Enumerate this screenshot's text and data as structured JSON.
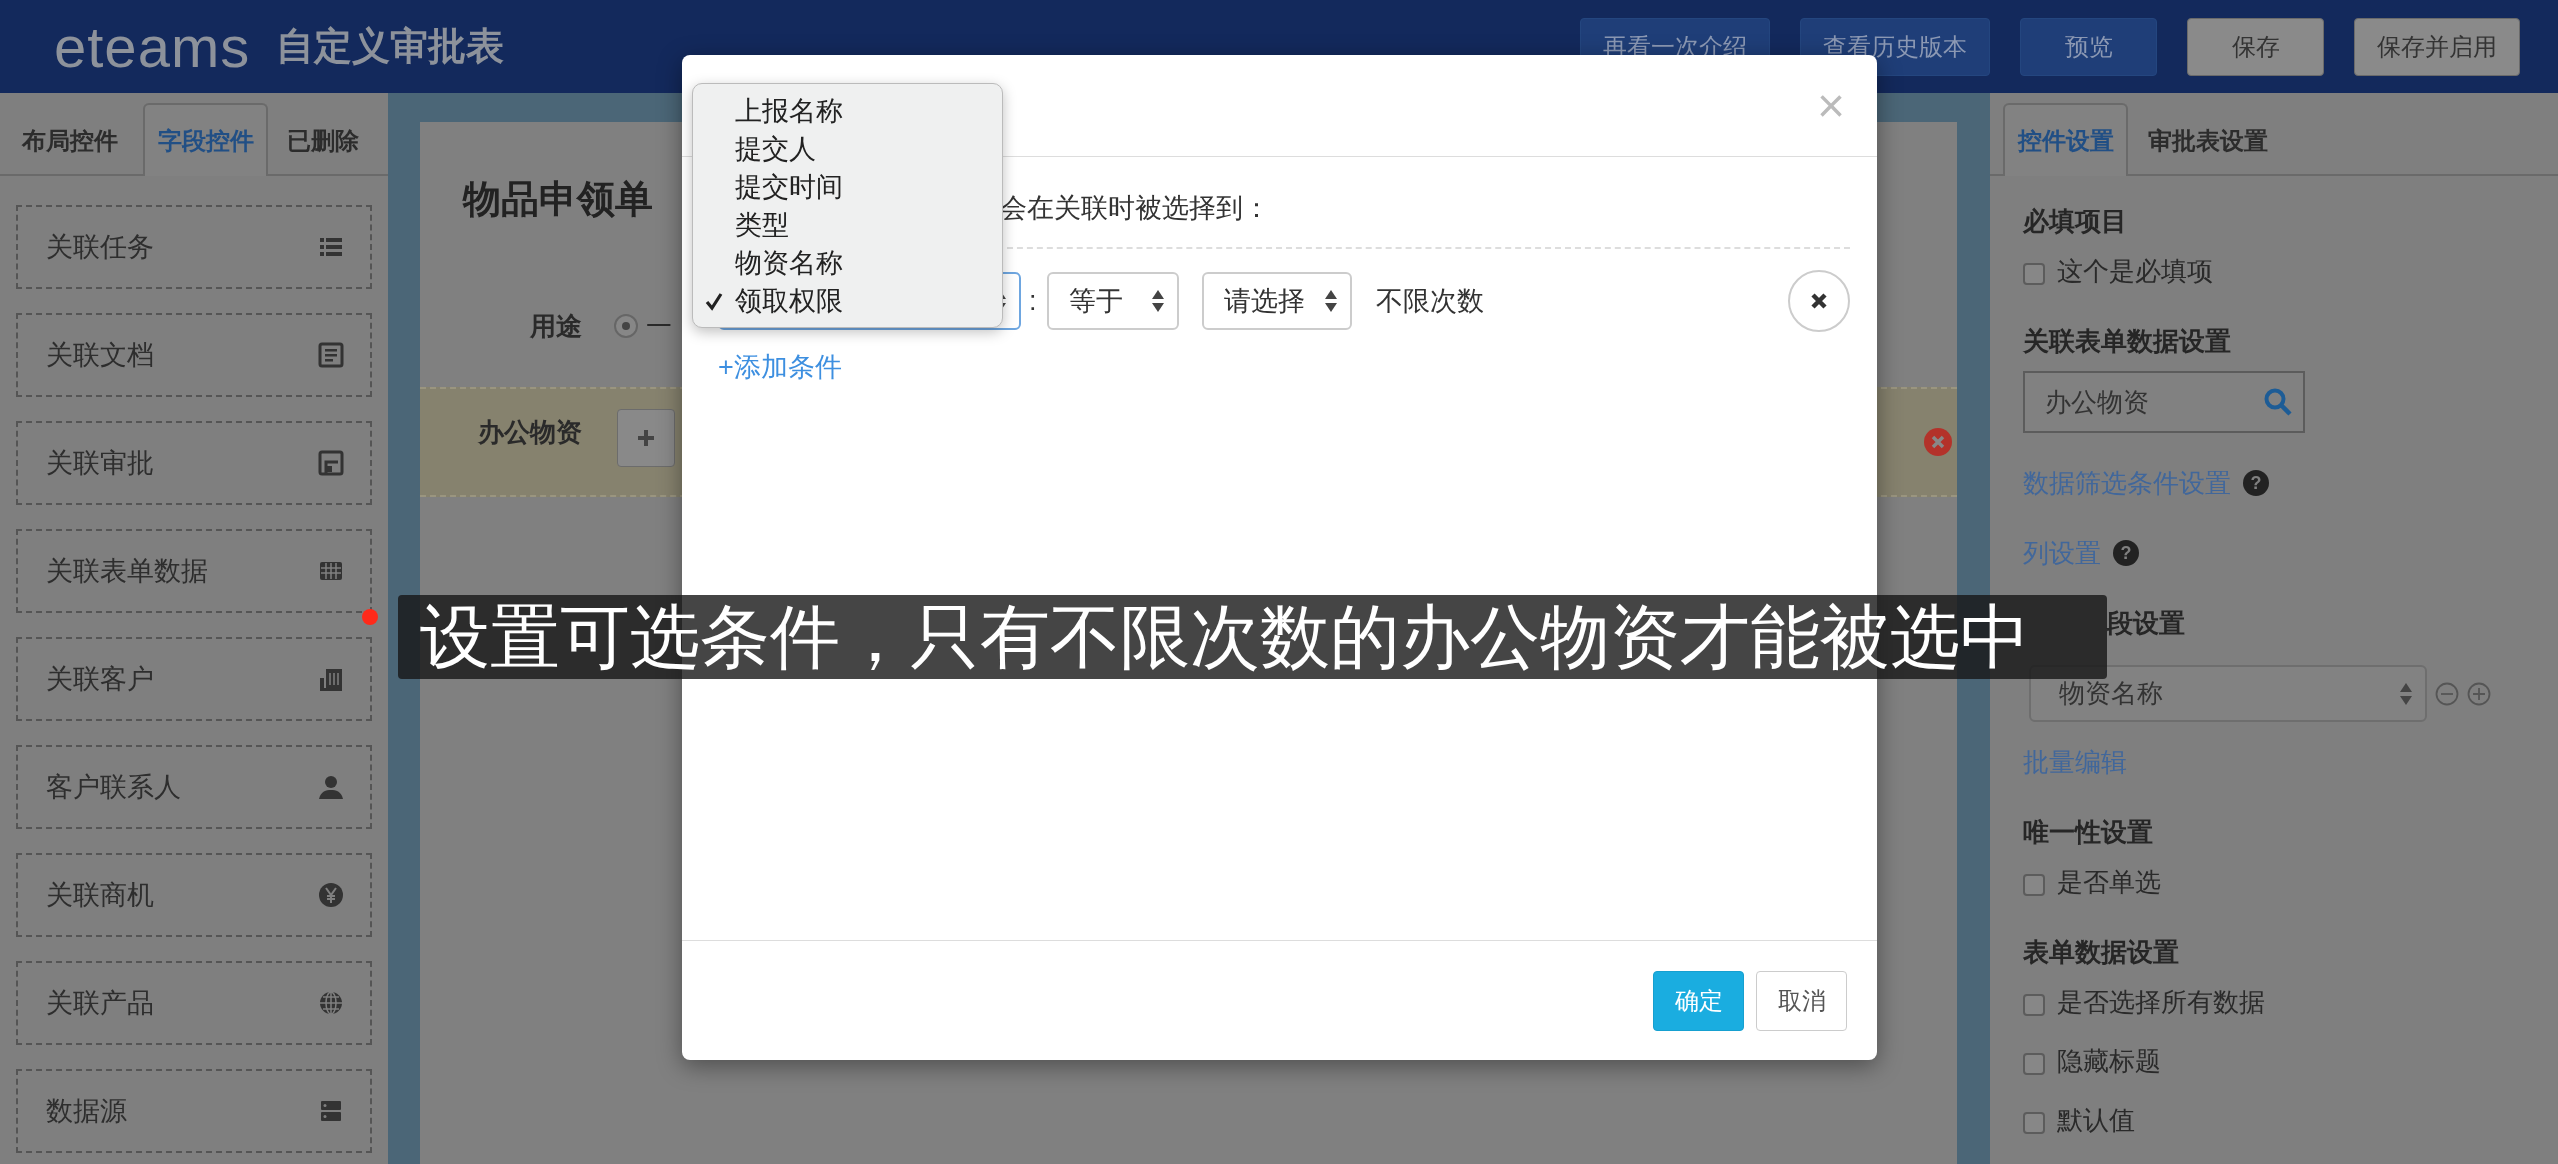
{
  "header": {
    "logo": "eteams",
    "title": "自定义审批表",
    "buttons": [
      {
        "label": "再看一次介绍",
        "kind": "dark"
      },
      {
        "label": "查看历史版本",
        "kind": "dark"
      },
      {
        "label": "预览",
        "kind": "dark"
      },
      {
        "label": "保存",
        "kind": "light"
      },
      {
        "label": "保存并启用",
        "kind": "light"
      }
    ]
  },
  "left_panel": {
    "tabs": [
      {
        "label": "布局控件",
        "selected": false
      },
      {
        "label": "字段控件",
        "selected": true
      },
      {
        "label": "已删除",
        "selected": false
      }
    ],
    "items": [
      {
        "label": "关联任务"
      },
      {
        "label": "关联文档"
      },
      {
        "label": "关联审批"
      },
      {
        "label": "关联表单数据"
      },
      {
        "label": "关联客户"
      },
      {
        "label": "客户联系人"
      },
      {
        "label": "关联商机"
      },
      {
        "label": "关联产品"
      },
      {
        "label": "数据源"
      }
    ]
  },
  "form": {
    "title": "物品申领单",
    "fields": [
      {
        "kind": "radio",
        "label": "用途",
        "option": "一",
        "checked": true
      },
      {
        "kind": "subtable",
        "label": "办公物资"
      }
    ]
  },
  "right_panel": {
    "tabs": [
      {
        "label": "控件设置",
        "selected": true
      },
      {
        "label": "审批表设置",
        "selected": false
      }
    ],
    "sections": [
      {
        "kind": "heading",
        "text": "必填项目"
      },
      {
        "kind": "checkbox",
        "label": "这个是必填项",
        "checked": false
      },
      {
        "kind": "heading",
        "text": "关联表单数据设置"
      },
      {
        "kind": "search",
        "value": "办公物资"
      },
      {
        "kind": "link",
        "text": "数据筛选条件设置",
        "help": "?"
      },
      {
        "kind": "link",
        "text": "列设置",
        "help": "?"
      },
      {
        "kind": "cut_heading",
        "text": "段设置"
      },
      {
        "kind": "select",
        "value": "物资名称"
      },
      {
        "kind": "link",
        "text": "批量编辑"
      },
      {
        "kind": "heading",
        "text": "唯一性设置"
      },
      {
        "kind": "checkbox",
        "label": "是否单选",
        "checked": false
      },
      {
        "kind": "heading",
        "text": "表单数据设置"
      },
      {
        "kind": "checkbox",
        "label": "是否选择所有数据",
        "checked": false
      },
      {
        "kind": "checkbox",
        "label": "隐藏标题",
        "checked": false
      },
      {
        "kind": "checkbox",
        "label": "默认值",
        "checked": false
      }
    ]
  },
  "modal": {
    "close": "×",
    "intro": "会在关联时被选择到：",
    "separator": ":",
    "condition": {
      "operator": "等于",
      "value_select": "请选择",
      "value_text": "不限次数"
    },
    "add_link": "+添加条件",
    "dropdown": {
      "options": [
        {
          "label": "上报名称",
          "selected": false
        },
        {
          "label": "提交人",
          "selected": false
        },
        {
          "label": "提交时间",
          "selected": false
        },
        {
          "label": "类型",
          "selected": false
        },
        {
          "label": "物资名称",
          "selected": false
        },
        {
          "label": "领取权限",
          "selected": true
        }
      ]
    },
    "buttons": [
      {
        "label": "确定",
        "primary": true
      },
      {
        "label": "取消",
        "primary": false
      }
    ]
  },
  "caption": {
    "text": "设置可选条件，只有不限次数的办公物资才能被选中"
  }
}
